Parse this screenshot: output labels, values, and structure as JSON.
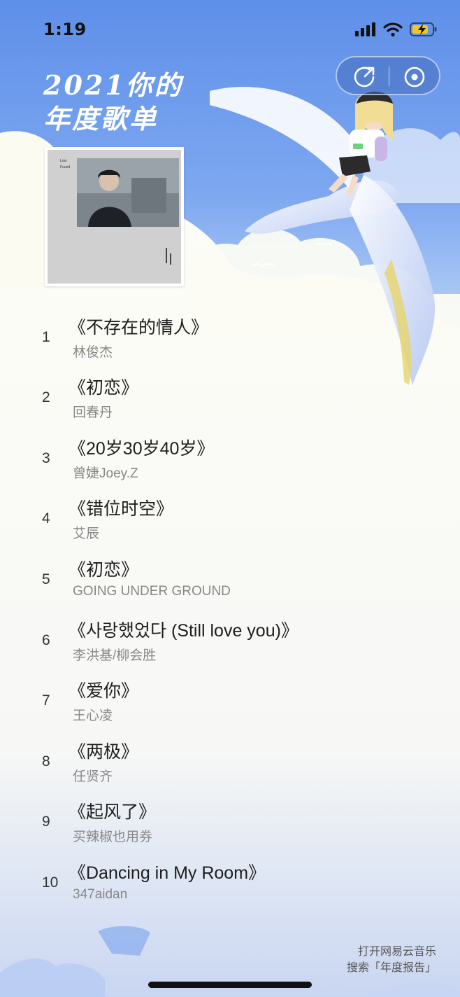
{
  "status_bar": {
    "time": "1:19"
  },
  "header": {
    "title_lines": [
      "2021你的",
      "年度歌单"
    ]
  },
  "actions": {
    "share_icon": "share-icon",
    "record_icon": "record-icon"
  },
  "songs": [
    {
      "rank": "1",
      "title": "《不存在的情人》",
      "artist": "林俊杰"
    },
    {
      "rank": "2",
      "title": "《初恋》",
      "artist": "回春丹"
    },
    {
      "rank": "3",
      "title": "《20岁30岁40岁》",
      "artist": "曾婕Joey.Z"
    },
    {
      "rank": "4",
      "title": "《错位时空》",
      "artist": "艾辰"
    },
    {
      "rank": "5",
      "title": "《初恋》",
      "artist": "GOING UNDER GROUND"
    },
    {
      "rank": "6",
      "title": "《사랑했었다 (Still love you)》",
      "artist": "李洪基/柳会胜"
    },
    {
      "rank": "7",
      "title": "《爱你》",
      "artist": "王心凌"
    },
    {
      "rank": "8",
      "title": "《两极》",
      "artist": "任贤齐"
    },
    {
      "rank": "9",
      "title": "《起风了》",
      "artist": "买辣椒也用券"
    },
    {
      "rank": "10",
      "title": "《Dancing in My Room》",
      "artist": "347aidan"
    }
  ],
  "footer": {
    "line1": "打开网易云音乐",
    "line2": "搜索「年度报告」"
  },
  "colors": {
    "sky": "#5f8fe8",
    "cream": "#fffff6",
    "title": "#ffffff"
  }
}
